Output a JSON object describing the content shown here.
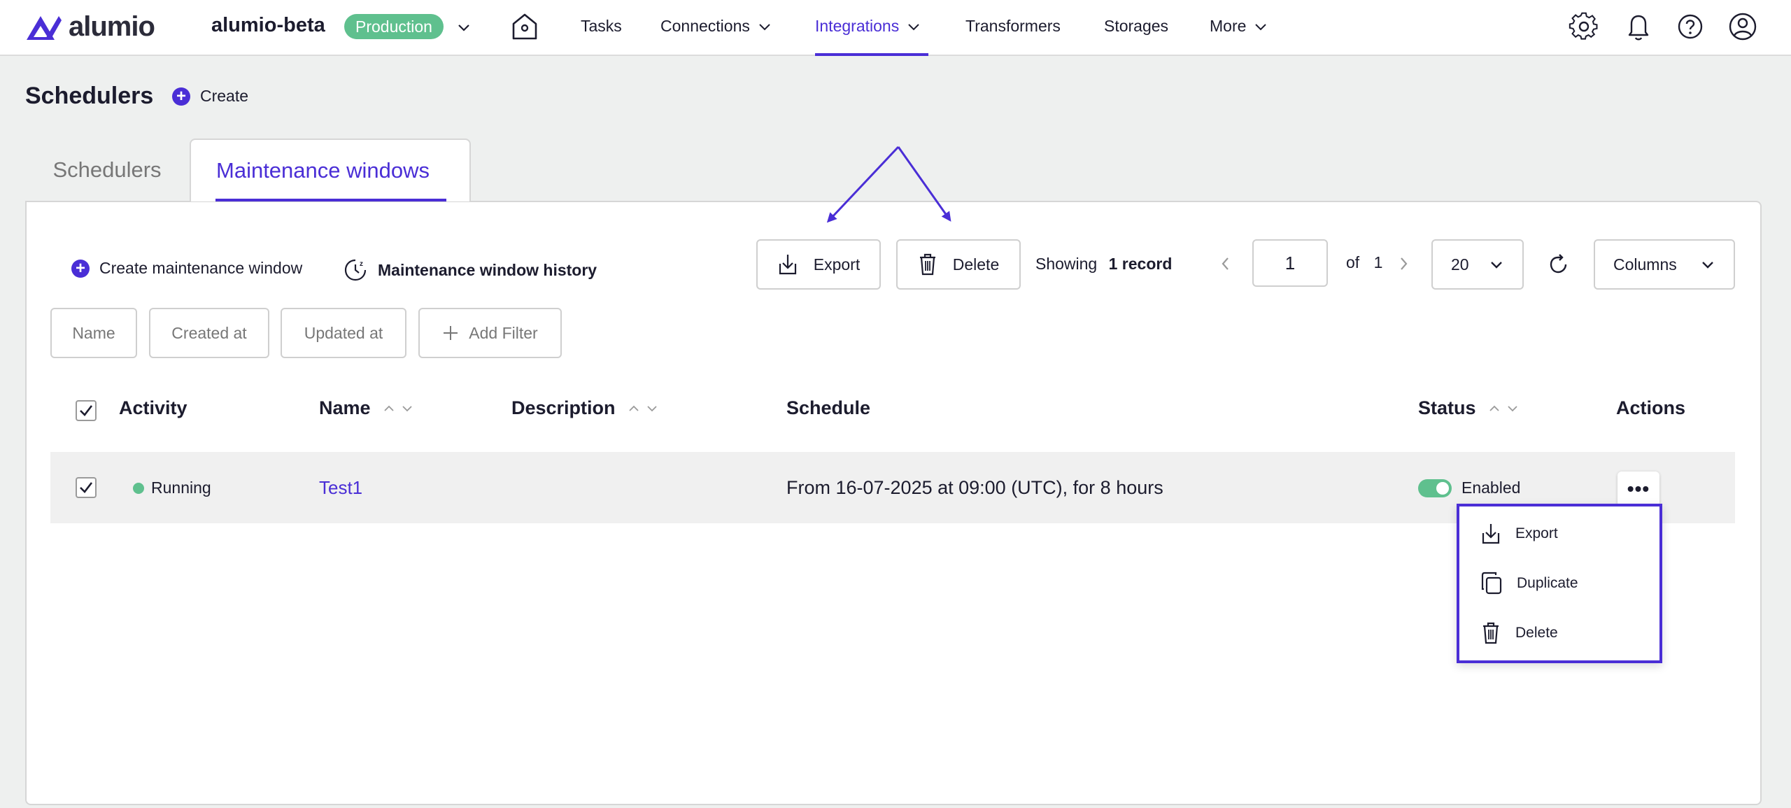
{
  "app": {
    "logo_text": "alumio",
    "environment_name": "alumio-beta",
    "environment_badge": "Production"
  },
  "nav": {
    "items": [
      {
        "label": "Tasks"
      },
      {
        "label": "Connections"
      },
      {
        "label": "Integrations",
        "active": true
      },
      {
        "label": "Transformers"
      },
      {
        "label": "Storages"
      },
      {
        "label": "More"
      }
    ]
  },
  "page": {
    "title": "Schedulers",
    "create_label": "Create"
  },
  "tabs": [
    {
      "label": "Schedulers"
    },
    {
      "label": "Maintenance windows",
      "active": true
    }
  ],
  "toolbar": {
    "create_mw_label": "Create maintenance window",
    "history_label": "Maintenance window history",
    "export_label": "Export",
    "delete_label": "Delete",
    "showing_label": "Showing",
    "record_count": "1 record",
    "current_page": "1",
    "of_label": "of",
    "total_pages": "1",
    "page_size": "20",
    "columns_label": "Columns"
  },
  "filters": [
    {
      "label": "Name"
    },
    {
      "label": "Created at"
    },
    {
      "label": "Updated at"
    },
    {
      "label": "Add Filter"
    }
  ],
  "table": {
    "headers": {
      "activity": "Activity",
      "name": "Name",
      "description": "Description",
      "schedule": "Schedule",
      "status": "Status",
      "actions": "Actions"
    },
    "rows": [
      {
        "activity": "Running",
        "name": "Test1",
        "description": "",
        "schedule": "From 16-07-2025 at 09:00 (UTC), for 8 hours",
        "status": "Enabled",
        "checked": true
      }
    ]
  },
  "actions_menu": {
    "items": [
      {
        "label": "Export"
      },
      {
        "label": "Duplicate"
      },
      {
        "label": "Delete"
      }
    ]
  },
  "colors": {
    "accent": "#4a2ed6",
    "success": "#5fc08e",
    "background": "#eef0ef"
  }
}
